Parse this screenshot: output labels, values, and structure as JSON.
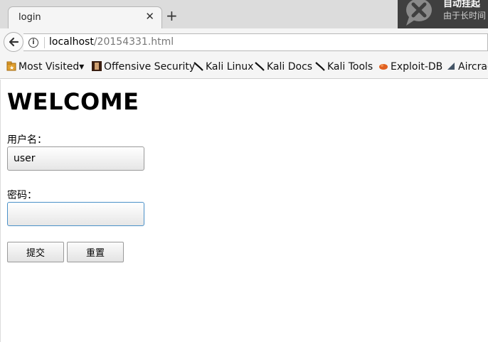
{
  "browser": {
    "tab_title": "login",
    "tab_close": "✕",
    "new_tab": "+",
    "url_host": "localhost",
    "url_path": "/20154331.html"
  },
  "notification": {
    "title": "自动挂起",
    "body": "由于长时间"
  },
  "bookmarks": [
    {
      "label": "Most Visited",
      "icon": "folder-icon",
      "dropdown": "▾"
    },
    {
      "label": "Offensive Security",
      "icon": "offsec-icon"
    },
    {
      "label": "Kali Linux",
      "icon": "kali-icon"
    },
    {
      "label": "Kali Docs",
      "icon": "kali-icon"
    },
    {
      "label": "Kali Tools",
      "icon": "kali-icon"
    },
    {
      "label": "Exploit-DB",
      "icon": "exploitdb-icon"
    },
    {
      "label": "Aircrack",
      "icon": "aircrack-icon"
    }
  ],
  "page": {
    "heading": "WELCOME",
    "username_label": "用户名：",
    "username_value": "user",
    "password_label": "密码：",
    "password_value": "",
    "submit_label": "提交",
    "reset_label": "重置"
  },
  "colors": {
    "focus_border": "#4a90c8",
    "notification_bg": "#3f3f3f"
  }
}
